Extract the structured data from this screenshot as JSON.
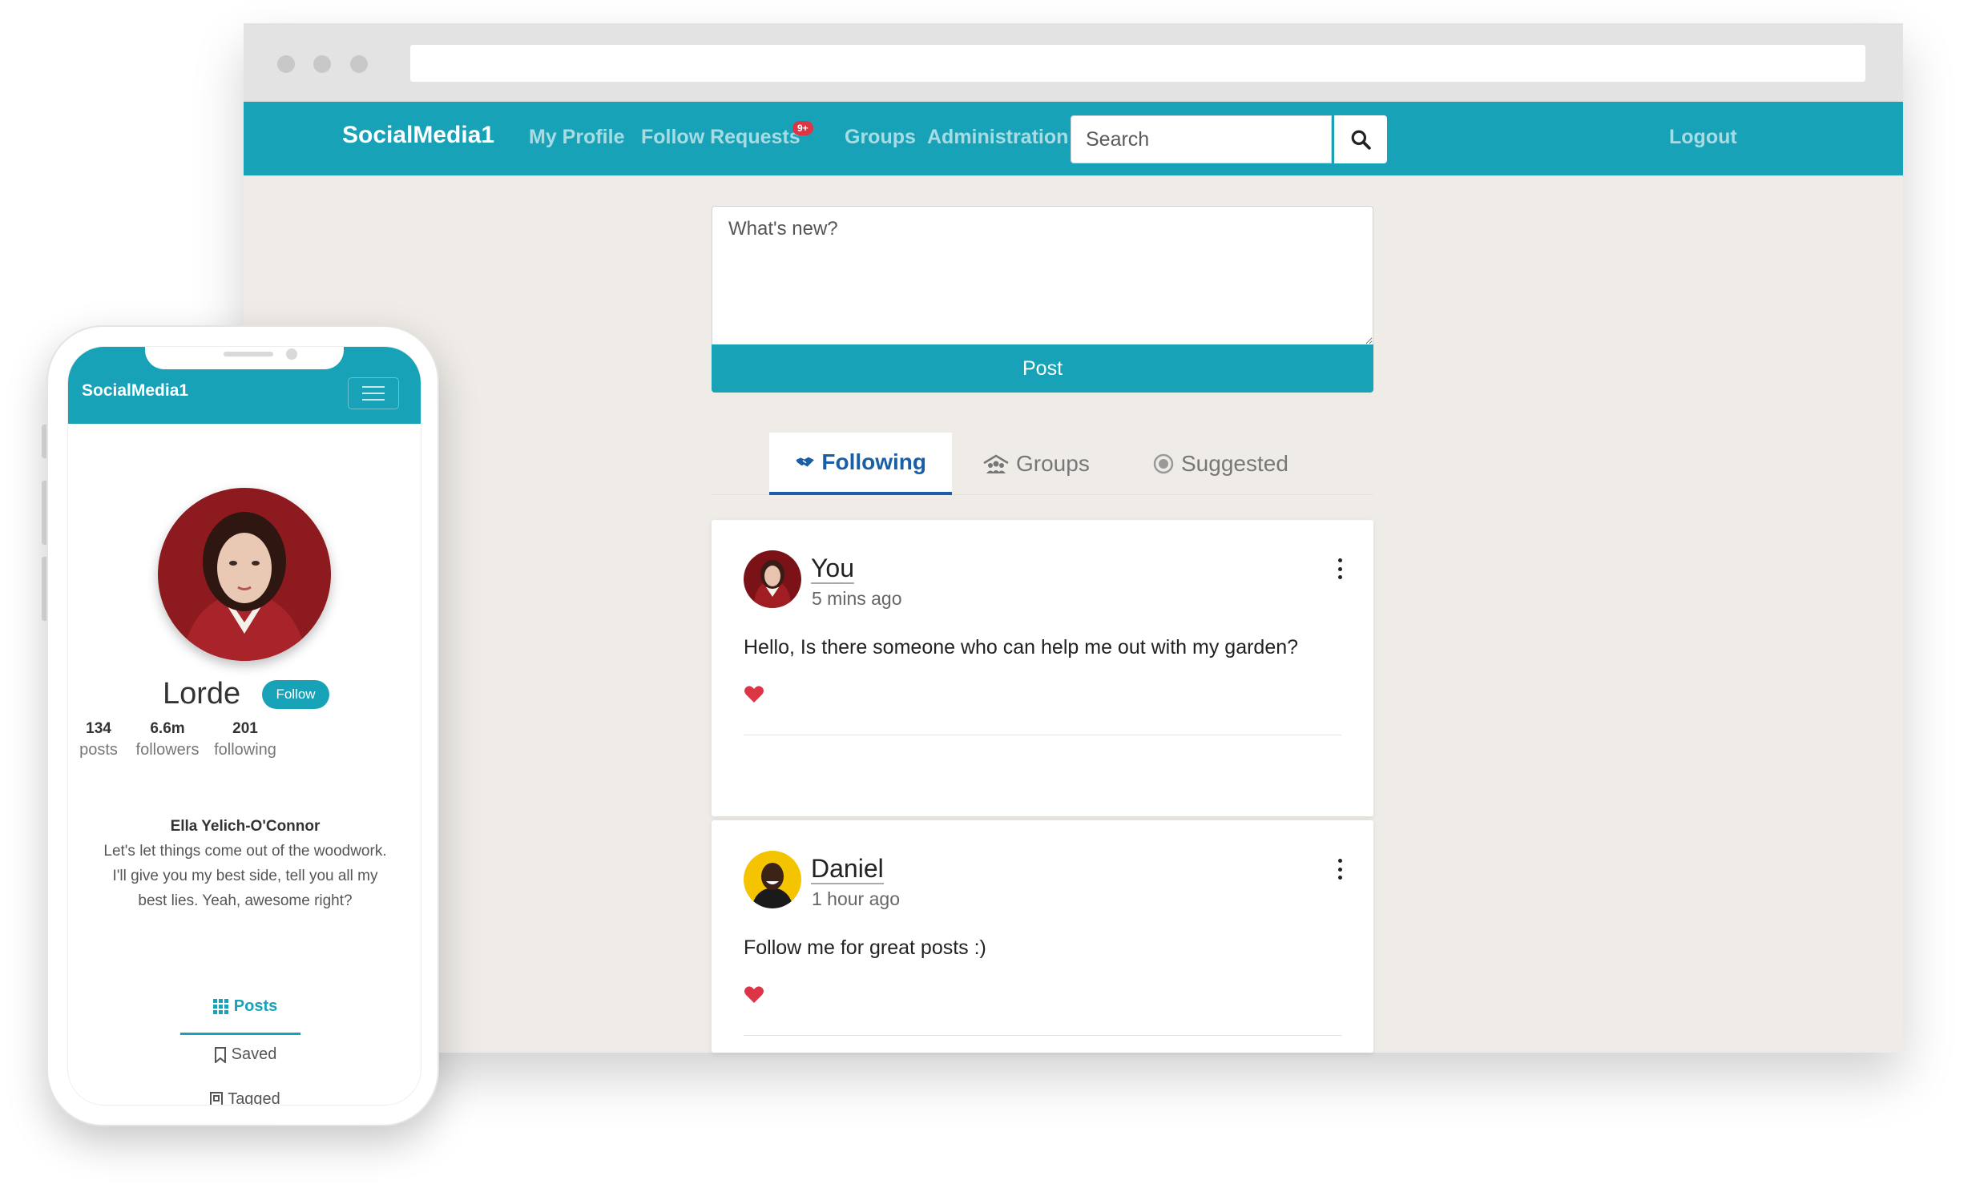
{
  "colors": {
    "primary": "#17a2b8",
    "tab_active": "#1a5ea5",
    "heart": "#dc3545",
    "page_bg": "#efece8"
  },
  "desktop": {
    "navbar": {
      "brand": "SocialMedia1",
      "links": [
        {
          "label": "My Profile"
        },
        {
          "label": "Follow Requests",
          "badge": "9+"
        },
        {
          "label": "Groups"
        },
        {
          "label": "Administration"
        }
      ],
      "search_placeholder": "Search",
      "search_icon": "search-icon",
      "logout": "Logout"
    },
    "composer": {
      "placeholder": "What's new?",
      "post_label": "Post"
    },
    "tabs": [
      {
        "label": "Following",
        "icon": "handshake-icon",
        "active": true
      },
      {
        "label": "Groups",
        "icon": "group-icon",
        "active": false
      },
      {
        "label": "Suggested",
        "icon": "dot-circle-icon",
        "active": false
      }
    ],
    "posts": [
      {
        "author": "You",
        "time": "5 mins ago",
        "text": "Hello, Is there someone who can help me out with my garden?",
        "liked": true
      },
      {
        "author": "Daniel",
        "time": "1 hour ago",
        "text": "Follow me for great posts :)",
        "liked": true
      }
    ]
  },
  "mobile": {
    "brand": "SocialMedia1",
    "profile": {
      "name": "Lorde",
      "follow_label": "Follow",
      "stats": [
        {
          "value": "134",
          "label": "posts"
        },
        {
          "value": "6.6m",
          "label": "followers"
        },
        {
          "value": "201",
          "label": "following"
        }
      ],
      "full_name": "Ella Yelich-O'Connor",
      "bio_lines": [
        "Let's let things come out of the woodwork.",
        "I'll give you my best side, tell you all my",
        "best lies. Yeah, awesome right?"
      ]
    },
    "tabs": [
      {
        "label": "Posts",
        "icon": "grid-icon",
        "active": true
      },
      {
        "label": "Saved",
        "icon": "bookmark-icon",
        "active": false
      },
      {
        "label": "Tagged",
        "icon": "tag-icon",
        "active": false
      }
    ]
  }
}
